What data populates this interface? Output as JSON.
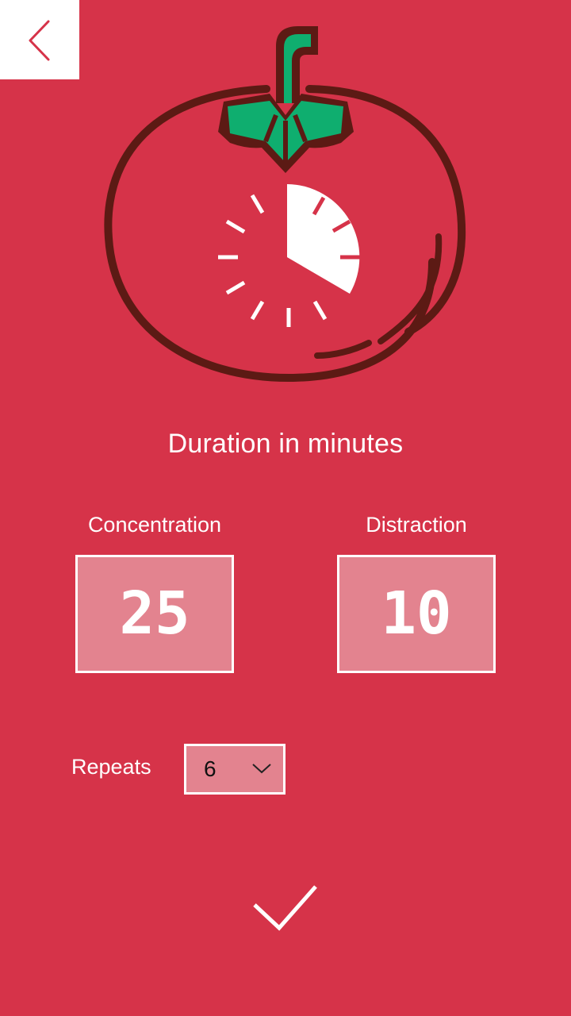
{
  "header": {
    "back_icon": "chevron-left-icon"
  },
  "illustration": {
    "icon": "tomato-timer-icon"
  },
  "settings": {
    "title": "Duration in minutes",
    "concentration": {
      "label": "Concentration",
      "value": "25"
    },
    "distraction": {
      "label": "Distraction",
      "value": "10"
    },
    "repeats": {
      "label": "Repeats",
      "value": "6",
      "icon": "chevron-down-icon"
    }
  },
  "actions": {
    "confirm_icon": "checkmark-icon"
  },
  "colors": {
    "background": "#d63349",
    "input_background": "#e3838f",
    "tomato_outline": "#5c1a14",
    "leaf_green": "#0fae6f",
    "white": "#ffffff"
  }
}
